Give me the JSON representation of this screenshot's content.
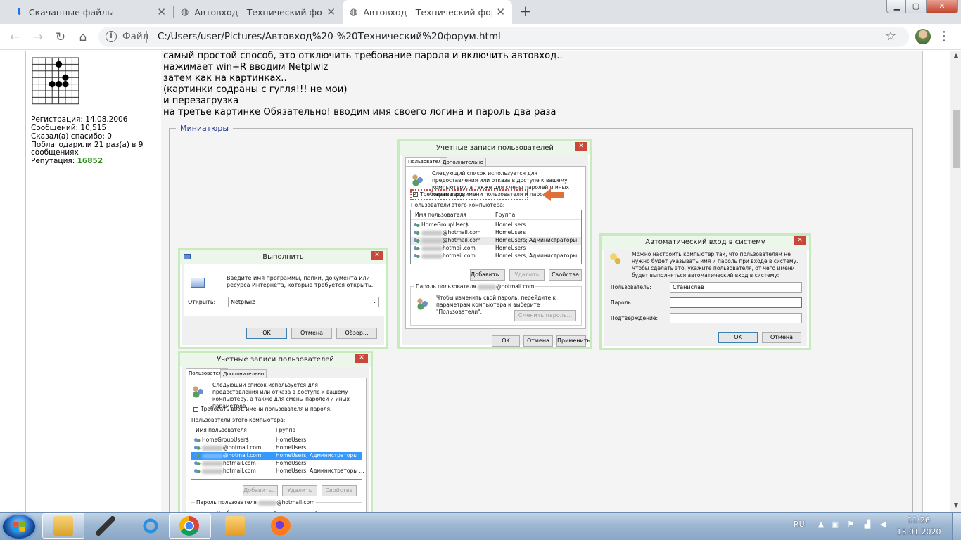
{
  "tabs": [
    {
      "title": "Скачанные файлы",
      "icon": "download-icon"
    },
    {
      "title": "Автовход - Технический форум",
      "icon": "globe-icon"
    },
    {
      "title": "Автовход - Технический форум",
      "icon": "globe-icon",
      "active": true
    }
  ],
  "omnibox": {
    "scheme_label": "Файл",
    "url": "C:/Users/user/Pictures/Автовход%20-%20Технический%20форум.html"
  },
  "user_info": {
    "registration": "Регистрация: 14.08.2006",
    "messages": "Сообщений: 10,515",
    "thanked": "Сказал(а) спасибо: 0",
    "thanked_by": "Поблагодарили 21 раз(а) в 9",
    "thanked_by_2": "сообщениях",
    "reputation_label": "Репутация:",
    "reputation_value": "16852",
    "reputation_color": "#2e8b1a"
  },
  "post": {
    "lines": [
      "самый простой способ, это отключить требование пароля и включить автовход..",
      "нажимает win+R вводим Netplwiz",
      "затем как на картинках..",
      "(картинки содраны с гугля!!! не мои)",
      "и перезагрузка",
      "на третье картинке Обязательно! вводим имя своего логина и пароль два раза"
    ],
    "fieldset_legend": "Миниатюры"
  },
  "run_dialog": {
    "title": "Выполнить",
    "description": "Введите имя программы, папки, документа или ресурса Интернета, которые требуется открыть.",
    "open_label": "Открыть:",
    "open_value": "Netplwiz",
    "ok": "OK",
    "cancel": "Отмена",
    "browse": "Обзор..."
  },
  "accounts_dialog": {
    "title": "Учетные записи пользователей",
    "tab_users": "Пользователи",
    "tab_advanced": "Дополнительно",
    "description": "Следующий список используется для предоставления или отказа в доступе к вашему компьютеру, а также для смены паролей и иных параметров.",
    "require_password": "Требовать ввод имени пользователя и пароля.",
    "users_label": "Пользователи этого компьютера:",
    "col_name": "Имя пользователя",
    "col_group": "Группа",
    "rows": [
      {
        "name": "HomeGroupUser$",
        "group": "HomeUsers"
      },
      {
        "name": "@hotmail.com",
        "group": "HomeUsers"
      },
      {
        "name": "@hotmail.com",
        "group": "HomeUsers; Администраторы"
      },
      {
        "name": "hotmail.com",
        "group": "HomeUsers"
      },
      {
        "name": "hotmail.com",
        "group": "HomeUsers; Администраторы ..."
      }
    ],
    "add": "Добавить...",
    "remove": "Удалить",
    "properties": "Свойства",
    "password_group": "Пароль пользователя",
    "password_group_suffix": "@hotmail.com",
    "password_hint": "Чтобы изменить свой пароль, перейдите к параметрам компьютера и выберите \"Пользователи\".",
    "change_password": "Сменить пароль...",
    "ok": "OK",
    "cancel": "Отмена",
    "apply": "Применить"
  },
  "autologon_dialog": {
    "title": "Автоматический вход в систему",
    "description": "Можно настроить компьютер так, что пользователям не нужно будет указывать имя и пароль при входе в систему. Чтобы сделать это, укажите пользователя, от чего имени будет выполняться автоматический вход в систему:",
    "user_label": "Пользователь:",
    "user_value": "Станислав",
    "password_label": "Пароль:",
    "confirm_label": "Подтверждение:",
    "ok": "OK",
    "cancel": "Отмена"
  },
  "taskbar": {
    "language": "RU",
    "time": "11:26",
    "date": "13.01.2020"
  }
}
